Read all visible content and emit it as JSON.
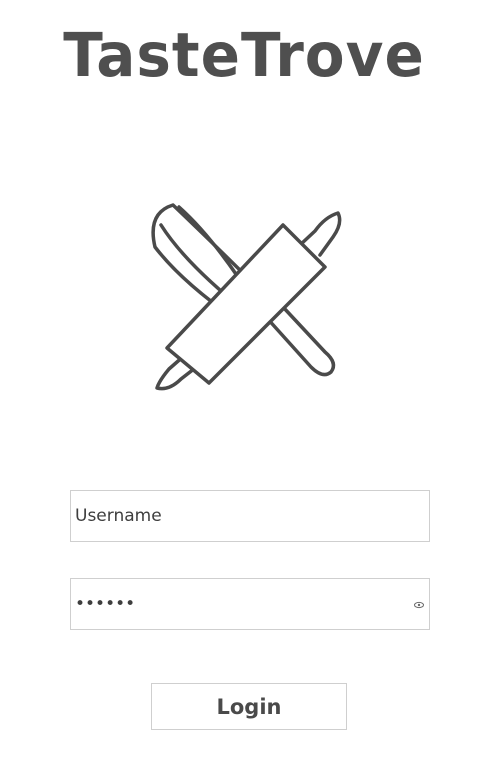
{
  "app": {
    "title": "TasteTrove",
    "logo_icon": "whisk-rolling-pin-icon"
  },
  "login": {
    "username": {
      "value": "Username"
    },
    "password": {
      "value": "••••••",
      "toggle_icon": "eye-icon"
    },
    "button_label": "Login"
  },
  "colors": {
    "text": "#4a4a4a",
    "border": "#cfcfcf",
    "background": "#ffffff"
  }
}
